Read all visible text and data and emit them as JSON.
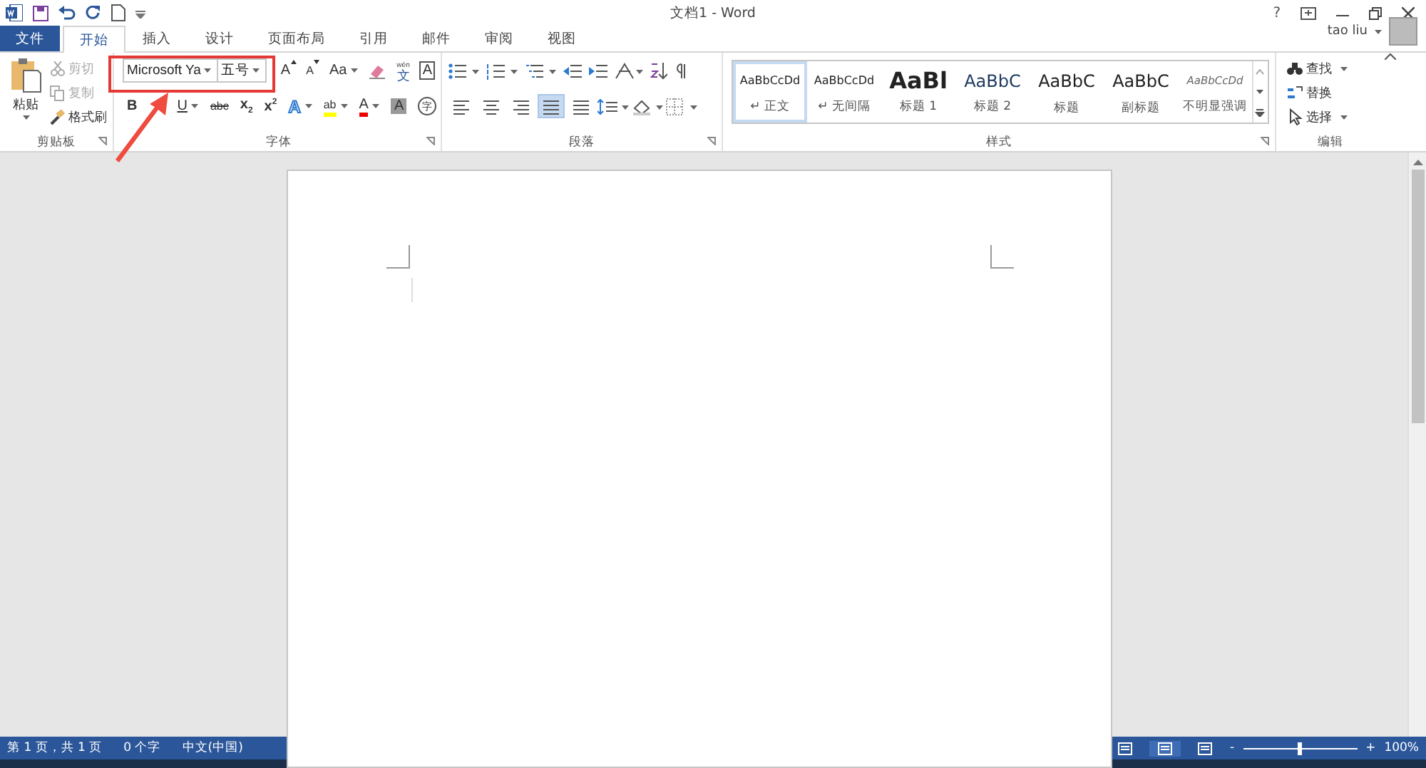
{
  "window": {
    "title": "文档1 - Word",
    "controls": [
      "?"
    ]
  },
  "user": {
    "name": "tao liu"
  },
  "tabs": [
    {
      "label": "文件",
      "kind": "file",
      "selected": false
    },
    {
      "label": "开始",
      "kind": "tab",
      "selected": true
    },
    {
      "label": "插入",
      "kind": "tab",
      "selected": false
    },
    {
      "label": "设计",
      "kind": "tab",
      "selected": false
    },
    {
      "label": "页面布局",
      "kind": "tab",
      "selected": false
    },
    {
      "label": "引用",
      "kind": "tab",
      "selected": false
    },
    {
      "label": "邮件",
      "kind": "tab",
      "selected": false
    },
    {
      "label": "审阅",
      "kind": "tab",
      "selected": false
    },
    {
      "label": "视图",
      "kind": "tab",
      "selected": false
    }
  ],
  "clipboard": {
    "label": "剪贴板",
    "paste": "粘贴",
    "items": [
      {
        "label": "剪切",
        "kind": "cut",
        "disabled": true
      },
      {
        "label": "复制",
        "kind": "copy",
        "disabled": true
      },
      {
        "label": "格式刷",
        "kind": "brush",
        "disabled": false
      }
    ]
  },
  "font": {
    "label": "字体",
    "name": "Microsoft Ya",
    "size": "五号",
    "row1": [
      {
        "kind": "grow",
        "text": "A"
      },
      {
        "kind": "shrink",
        "text": "A"
      },
      {
        "kind": "case",
        "text": "Aa"
      },
      {
        "kind": "clear"
      },
      {
        "kind": "phonetic",
        "text": "文",
        "ruby": "wén"
      },
      {
        "kind": "border",
        "text": "A"
      }
    ],
    "row2": [
      {
        "kind": "bold",
        "text": "B"
      },
      {
        "kind": "underline",
        "text": "U"
      },
      {
        "kind": "strike",
        "text": "abc"
      },
      {
        "kind": "sub",
        "text": "x",
        "small": "2"
      },
      {
        "kind": "sup",
        "text": "x",
        "small": "2"
      },
      {
        "kind": "effect",
        "text": "A"
      },
      {
        "kind": "highlight",
        "text": "ab"
      },
      {
        "kind": "color",
        "text": "A"
      },
      {
        "kind": "shade",
        "text": "A"
      },
      {
        "kind": "enclose",
        "text": "字"
      }
    ]
  },
  "paragraph": {
    "label": "段落",
    "align": [
      {
        "selected": false
      },
      {
        "selected": false
      },
      {
        "selected": false
      },
      {
        "selected": true
      },
      {
        "selected": false
      }
    ]
  },
  "styles": {
    "label": "样式",
    "items": [
      {
        "sample": "AaBbCcDd",
        "name": "↵ 正文",
        "kind": "normal",
        "selected": true
      },
      {
        "sample": "AaBbCcDd",
        "name": "↵ 无间隔",
        "kind": "normal",
        "selected": false
      },
      {
        "sample": "AaBl",
        "name": "标题 1",
        "kind": "h1",
        "selected": false
      },
      {
        "sample": "AaBbC",
        "name": "标题 2",
        "kind": "h2",
        "selected": false
      },
      {
        "sample": "AaBbC",
        "name": "标题",
        "kind": "title",
        "selected": false
      },
      {
        "sample": "AaBbC",
        "name": "副标题",
        "kind": "title",
        "selected": false
      },
      {
        "sample": "AaBbCcDd",
        "name": "不明显强调",
        "kind": "emph",
        "selected": false
      }
    ]
  },
  "editing": {
    "label": "编辑",
    "items": [
      {
        "label": "查找",
        "kind": "find"
      },
      {
        "label": "替换",
        "kind": "replace"
      },
      {
        "label": "选择",
        "kind": "select"
      }
    ]
  },
  "status_bar": {
    "items": [
      "第 1 页，共 1 页",
      "0 个字",
      "中文(中国)"
    ],
    "views": [
      {
        "selected": false
      },
      {
        "selected": true
      },
      {
        "selected": false
      }
    ],
    "zoom": {
      "level": 0.48,
      "minus": "-",
      "plus": "+",
      "reading": "100%"
    }
  }
}
